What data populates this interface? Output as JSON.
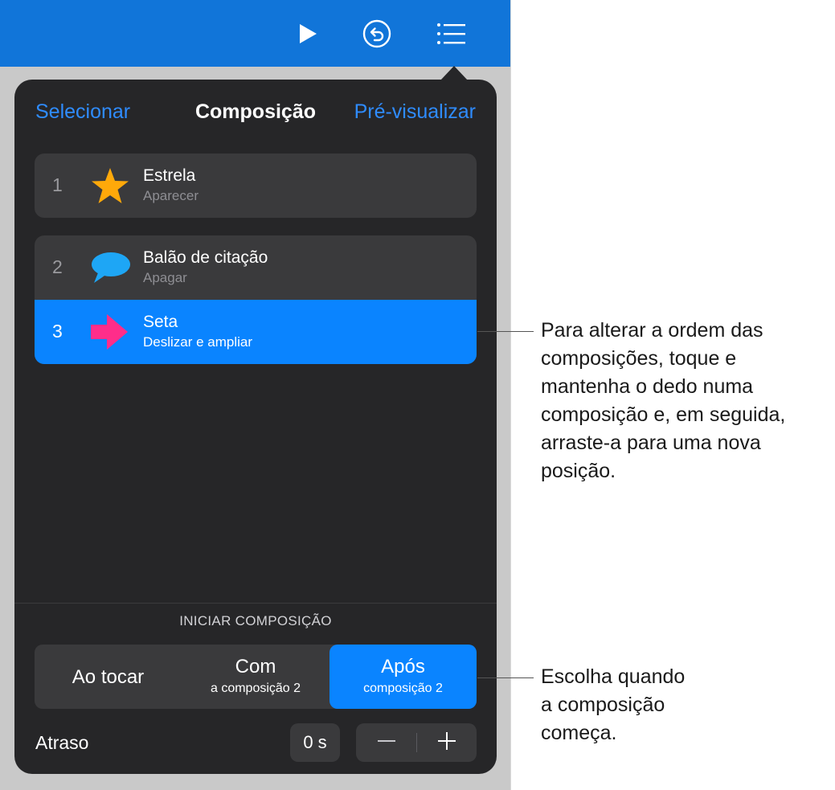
{
  "toolbar": {
    "icons": [
      "play-icon",
      "undo-icon",
      "list-icon"
    ],
    "color": "#1175d9"
  },
  "popover": {
    "select_label": "Selecionar",
    "title": "Composição",
    "preview_label": "Pré-visualizar",
    "builds": [
      {
        "number": "1",
        "name": "Estrela",
        "effect": "Aparecer",
        "icon": "star-icon"
      },
      {
        "number": "2",
        "name": "Balão de citação",
        "effect": "Apagar",
        "icon": "speech-bubble-icon"
      },
      {
        "number": "3",
        "name": "Seta",
        "effect": "Deslizar e ampliar",
        "icon": "arrow-icon",
        "selected": true
      }
    ],
    "start_section_label": "INICIAR COMPOSIÇÃO",
    "start_options": [
      {
        "label": "Ao tocar",
        "sub": ""
      },
      {
        "label": "Com",
        "sub": "a composição 2"
      },
      {
        "label": "Após",
        "sub": "composição 2",
        "active": true
      }
    ],
    "delay_label": "Atraso",
    "delay_value": "0 s",
    "decrement_label": "−",
    "increment_label": "+"
  },
  "callouts": {
    "reorder": [
      "Para alterar a ordem das",
      "composições, toque e",
      "mantenha o dedo numa",
      "composição e, em seguida,",
      "arraste-a para uma nova",
      "posição."
    ],
    "start": [
      "Escolha quando",
      "a composição",
      "começa."
    ]
  },
  "colors": {
    "accent": "#0a84ff",
    "link": "#2f8cff",
    "popover_bg": "#262628",
    "row_bg": "#3a3a3c",
    "star": "#ffa90a",
    "bubble": "#1ea6f5",
    "arrow": "#ff2d8a"
  }
}
